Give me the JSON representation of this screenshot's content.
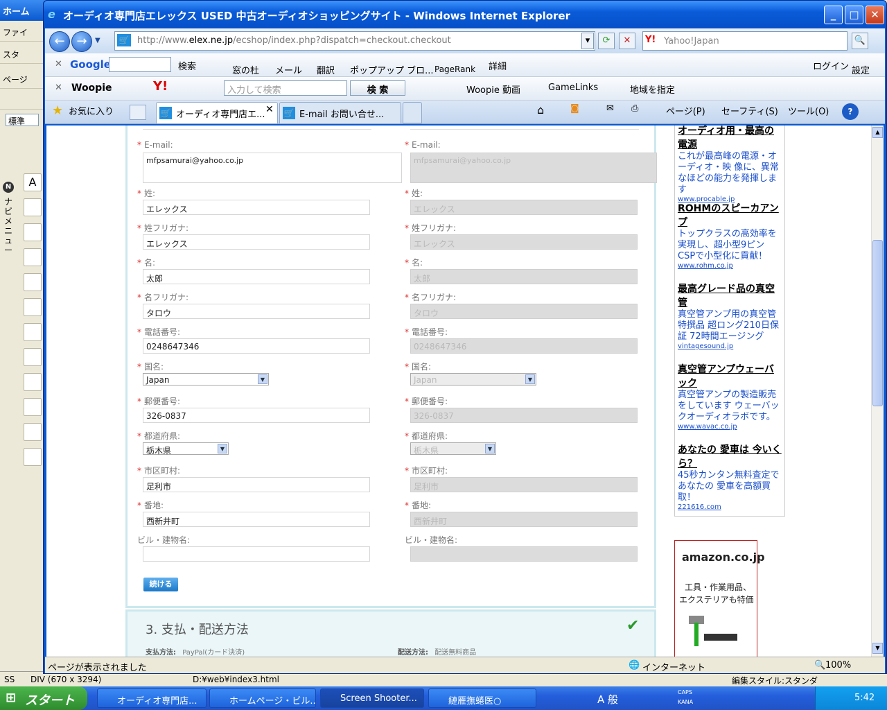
{
  "bg_window": {
    "title": "ホーム",
    "menu1": "ファイ",
    "menu2": "スタ",
    "menu3": "ページ",
    "style": "標準",
    "nav_label": "ナビメニュー",
    "status_left": "SS",
    "status_div": "DIV (670 x 3294)",
    "status_path": "D:¥web¥index3.html",
    "status_right": "編集スタイル:スタンダ"
  },
  "ie": {
    "title": "オーディオ専門店エレックス USED 中古オーディオショッピングサイト - Windows Internet Explorer",
    "address_prefix": "http://www.",
    "address_host": "elex.ne.jp",
    "address_rest": "/ecshop/index.php?dispatch=checkout.checkout",
    "search_placeholder": "Yahoo!Japan",
    "search_logo": "Y!",
    "google_toolbar": {
      "logo": "Google",
      "search": "検索",
      "window": "窓の杜",
      "mail": "メール",
      "translate": "翻訳",
      "popup": "ポップアップ ブロ...",
      "pagerank": "PageRank",
      "details": "詳細",
      "login": "ログイン",
      "settings": "設定"
    },
    "woopie_toolbar": {
      "logo": "Woopie",
      "yahoo": "Y!",
      "input_placeholder": "入力して検索",
      "search_btn": "検 索",
      "video": "Woopie 動画",
      "gamelinks": "GameLinks",
      "region": "地域を指定"
    },
    "favorites": "お気に入り",
    "tabs": [
      {
        "label": "オーディオ専門店エ..."
      },
      {
        "label": "E-mail お問い合せ..."
      }
    ],
    "commandbar": {
      "page": "ページ(P)",
      "safety": "セーフティ(S)",
      "tools": "ツール(O)"
    },
    "status": {
      "text": "ページが表示されました",
      "zone": "インターネット",
      "zoom": "100%"
    }
  },
  "form": {
    "required_mark": "*",
    "left": [
      {
        "label": "E-mail:",
        "value": "mfpsamurai@yahoo.co.jp",
        "required": true
      },
      {
        "label": "姓:",
        "value": "エレックス",
        "required": true
      },
      {
        "label": "姓フリガナ:",
        "value": "エレックス",
        "required": true
      },
      {
        "label": "名:",
        "value": "太郎",
        "required": true
      },
      {
        "label": "名フリガナ:",
        "value": "タロウ",
        "required": true
      },
      {
        "label": "電話番号:",
        "value": "0248647346",
        "required": true
      },
      {
        "label": "国名:",
        "value": "Japan",
        "required": true
      },
      {
        "label": "郵便番号:",
        "value": "326-0837",
        "required": true
      },
      {
        "label": "都道府県:",
        "value": "栃木県",
        "required": true
      },
      {
        "label": "市区町村:",
        "value": "足利市",
        "required": true
      },
      {
        "label": "番地:",
        "value": "西新井町",
        "required": true
      },
      {
        "label": "ビル・建物名:",
        "value": "",
        "required": false
      }
    ],
    "continue_button": "続ける"
  },
  "section3": {
    "title": "3. 支払・配送方法",
    "payment_label": "支払方法:",
    "payment_value": "PayPal(カード決済)",
    "shipping_label": "配送方法:",
    "shipping_value": "配送無料商品"
  },
  "ads": [
    {
      "title": "オーディオ用・最高の電源",
      "desc": "これが最高峰の電源・オーディオ・映 像に、異常なほどの能力を発揮します",
      "url": "www.procable.jp"
    },
    {
      "title": "ROHMのスピーカアンプ",
      "desc": "トップクラスの高効率を実現し、超小型9ピンCSPで小型化に貢献！",
      "url": "www.rohm.co.jp"
    },
    {
      "title": "最高グレード品の真空管",
      "desc": "真空管アンプ用の真空管 特撰品 超ロング210日保証 72時間エージング",
      "url": "vintagesound.jp"
    },
    {
      "title": "真空管アンプウェーバック",
      "desc": "真空管アンプの製造販売をしています ウェーバックオーディオラボです。",
      "url": "www.wavac.co.jp"
    },
    {
      "title": "あなたの 愛車は 今いくら？",
      "desc": "45秒カンタン無料査定で あなたの 愛車を高額買取！",
      "url": "221616.com"
    }
  ],
  "amazon": {
    "logo": "amazon.co.jp",
    "text1": "工具・作業用品、",
    "text2": "エクステリアも特価"
  },
  "taskbar": {
    "start": "スタート",
    "tasks": [
      {
        "label": "オーディオ専門店..."
      },
      {
        "label": "ホームページ・ビル..."
      },
      {
        "label": "Screen Shooter..."
      },
      {
        "label": "縺雁撫蜷医○"
      }
    ],
    "ime": "A 般",
    "caps": "CAPS",
    "kana": "KANA",
    "time": "5:42"
  }
}
